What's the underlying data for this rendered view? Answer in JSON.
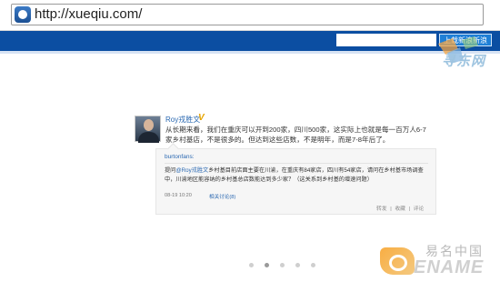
{
  "browser": {
    "url": "http://xueqiu.com/"
  },
  "header": {
    "search_placeholder": "",
    "search_button_label": "上载新浪新浪"
  },
  "watermark_top": {
    "text": "寻东网"
  },
  "tweet": {
    "author": "Roy戎胜文",
    "text": "从长期来看，我们在重庆可以开到200家，四川500家，这实际上也就是每一百万人6-7家乡村基店，不是很多的。但达到这些店数，不是明年，而是7-8年后了。",
    "retweet": {
      "author": "burtonfans:",
      "prefix": "提问",
      "mention": "@Roy戎胜文",
      "text": "乡村基目前店面主要在川渝，在重庆有84家店，四川有54家店，请问在乡村基市场调查中，川渝地区能容纳的乡村基总店数能达到多少家？（这关系到乡村基的增速问题）",
      "time": "08-19 10:20",
      "discussion_link": "相关讨论(8)"
    },
    "actions": [
      "转发",
      "收藏",
      "评论"
    ]
  },
  "pagination": {
    "count": 5,
    "active_index": 1
  },
  "watermark_bottom": {
    "cn": "易名中国",
    "en": "ENAME"
  }
}
